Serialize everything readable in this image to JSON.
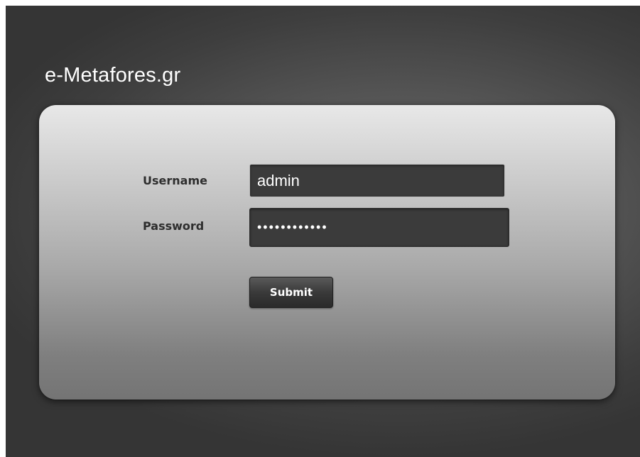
{
  "site": {
    "title": "e-Metafores.gr"
  },
  "login_form": {
    "username_label": "Username",
    "username_value": "admin",
    "password_label": "Password",
    "password_value": "••••••••••••",
    "submit_label": "Submit"
  },
  "colors": {
    "background": "#4a4a4a",
    "panel_top": "#e8e8e8",
    "panel_bottom": "#747474",
    "input_bg": "#3b3b3b",
    "text_light": "#ffffff",
    "label_text": "#2e2e2e"
  }
}
